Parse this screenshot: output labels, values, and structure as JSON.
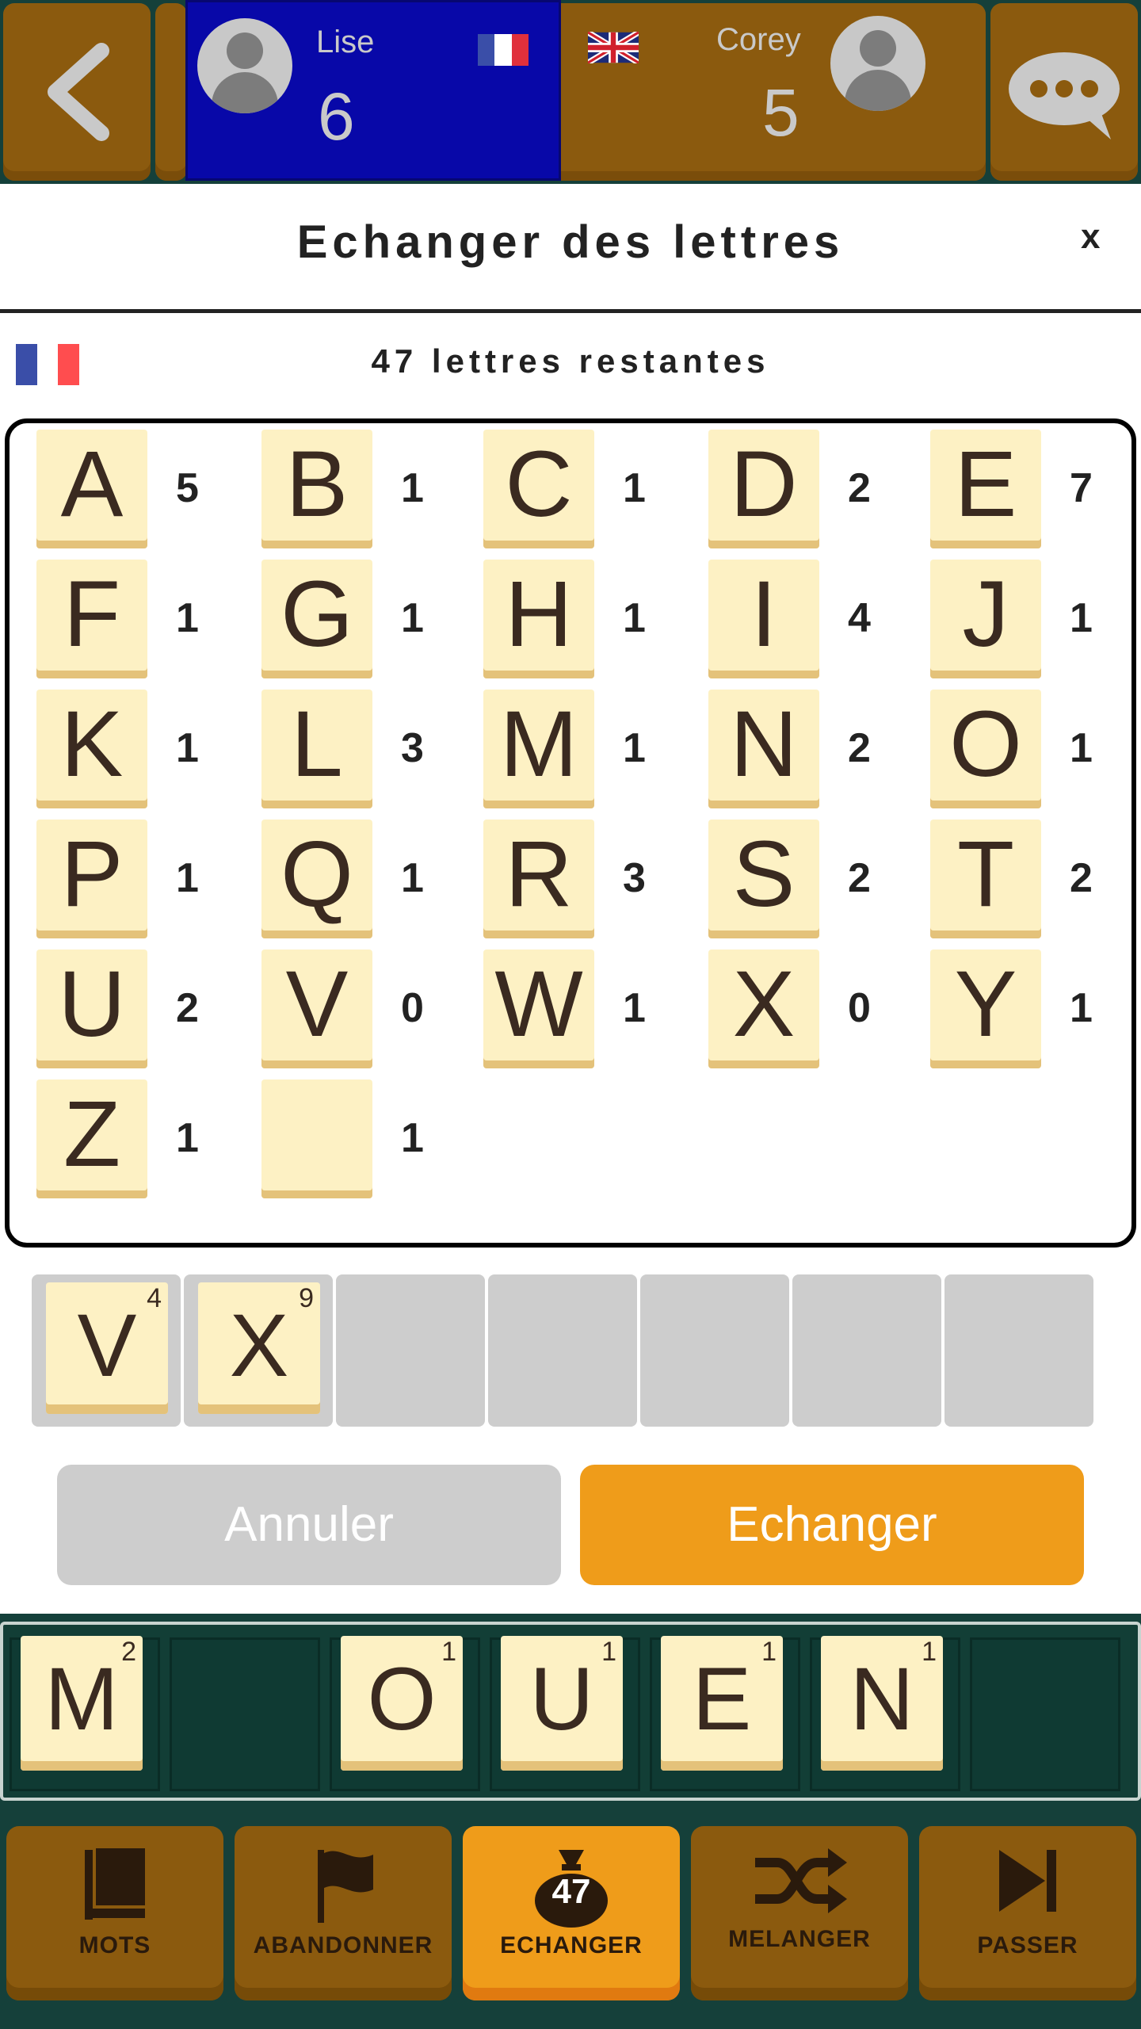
{
  "header": {
    "player1": {
      "name": "Lise",
      "score": "6"
    },
    "player2": {
      "name": "Corey",
      "score": "5"
    }
  },
  "modal": {
    "title": "Echanger des lettres",
    "close_label": "x",
    "remaining_text": "47 lettres restantes",
    "letters": [
      {
        "letter": "A",
        "count": "5"
      },
      {
        "letter": "B",
        "count": "1"
      },
      {
        "letter": "C",
        "count": "1"
      },
      {
        "letter": "D",
        "count": "2"
      },
      {
        "letter": "E",
        "count": "7"
      },
      {
        "letter": "F",
        "count": "1"
      },
      {
        "letter": "G",
        "count": "1"
      },
      {
        "letter": "H",
        "count": "1"
      },
      {
        "letter": "I",
        "count": "4"
      },
      {
        "letter": "J",
        "count": "1"
      },
      {
        "letter": "K",
        "count": "1"
      },
      {
        "letter": "L",
        "count": "3"
      },
      {
        "letter": "M",
        "count": "1"
      },
      {
        "letter": "N",
        "count": "2"
      },
      {
        "letter": "O",
        "count": "1"
      },
      {
        "letter": "P",
        "count": "1"
      },
      {
        "letter": "Q",
        "count": "1"
      },
      {
        "letter": "R",
        "count": "3"
      },
      {
        "letter": "S",
        "count": "2"
      },
      {
        "letter": "T",
        "count": "2"
      },
      {
        "letter": "U",
        "count": "2"
      },
      {
        "letter": "V",
        "count": "0"
      },
      {
        "letter": "W",
        "count": "1"
      },
      {
        "letter": "X",
        "count": "0"
      },
      {
        "letter": "Y",
        "count": "1"
      },
      {
        "letter": "Z",
        "count": "1"
      },
      {
        "letter": "",
        "count": "1"
      }
    ],
    "selected_tiles": [
      {
        "letter": "V",
        "value": "4"
      },
      {
        "letter": "X",
        "value": "9"
      }
    ],
    "cancel_label": "Annuler",
    "exchange_label": "Echanger"
  },
  "rack": {
    "tiles": [
      {
        "letter": "M",
        "value": "2"
      },
      null,
      {
        "letter": "O",
        "value": "1"
      },
      {
        "letter": "U",
        "value": "1"
      },
      {
        "letter": "E",
        "value": "1"
      },
      {
        "letter": "N",
        "value": "1"
      },
      null
    ]
  },
  "bottom_nav": {
    "words_label": "MOTS",
    "resign_label": "ABANDONNER",
    "exchange_label": "ECHANGER",
    "bag_count": "47",
    "shuffle_label": "MELANGER",
    "pass_label": "PASSER"
  },
  "colors": {
    "background": "#15403a",
    "button_brown": "#8b5a0e",
    "accent_orange": "#ef9c1a",
    "player_active_blue": "#0808a8",
    "tile_cream": "#fdf1c4"
  },
  "icons": [
    "back-arrow-icon",
    "chat-bubble-icon",
    "france-flag-icon",
    "uk-flag-icon",
    "book-icon",
    "flag-icon",
    "bag-icon",
    "shuffle-icon",
    "skip-icon"
  ]
}
